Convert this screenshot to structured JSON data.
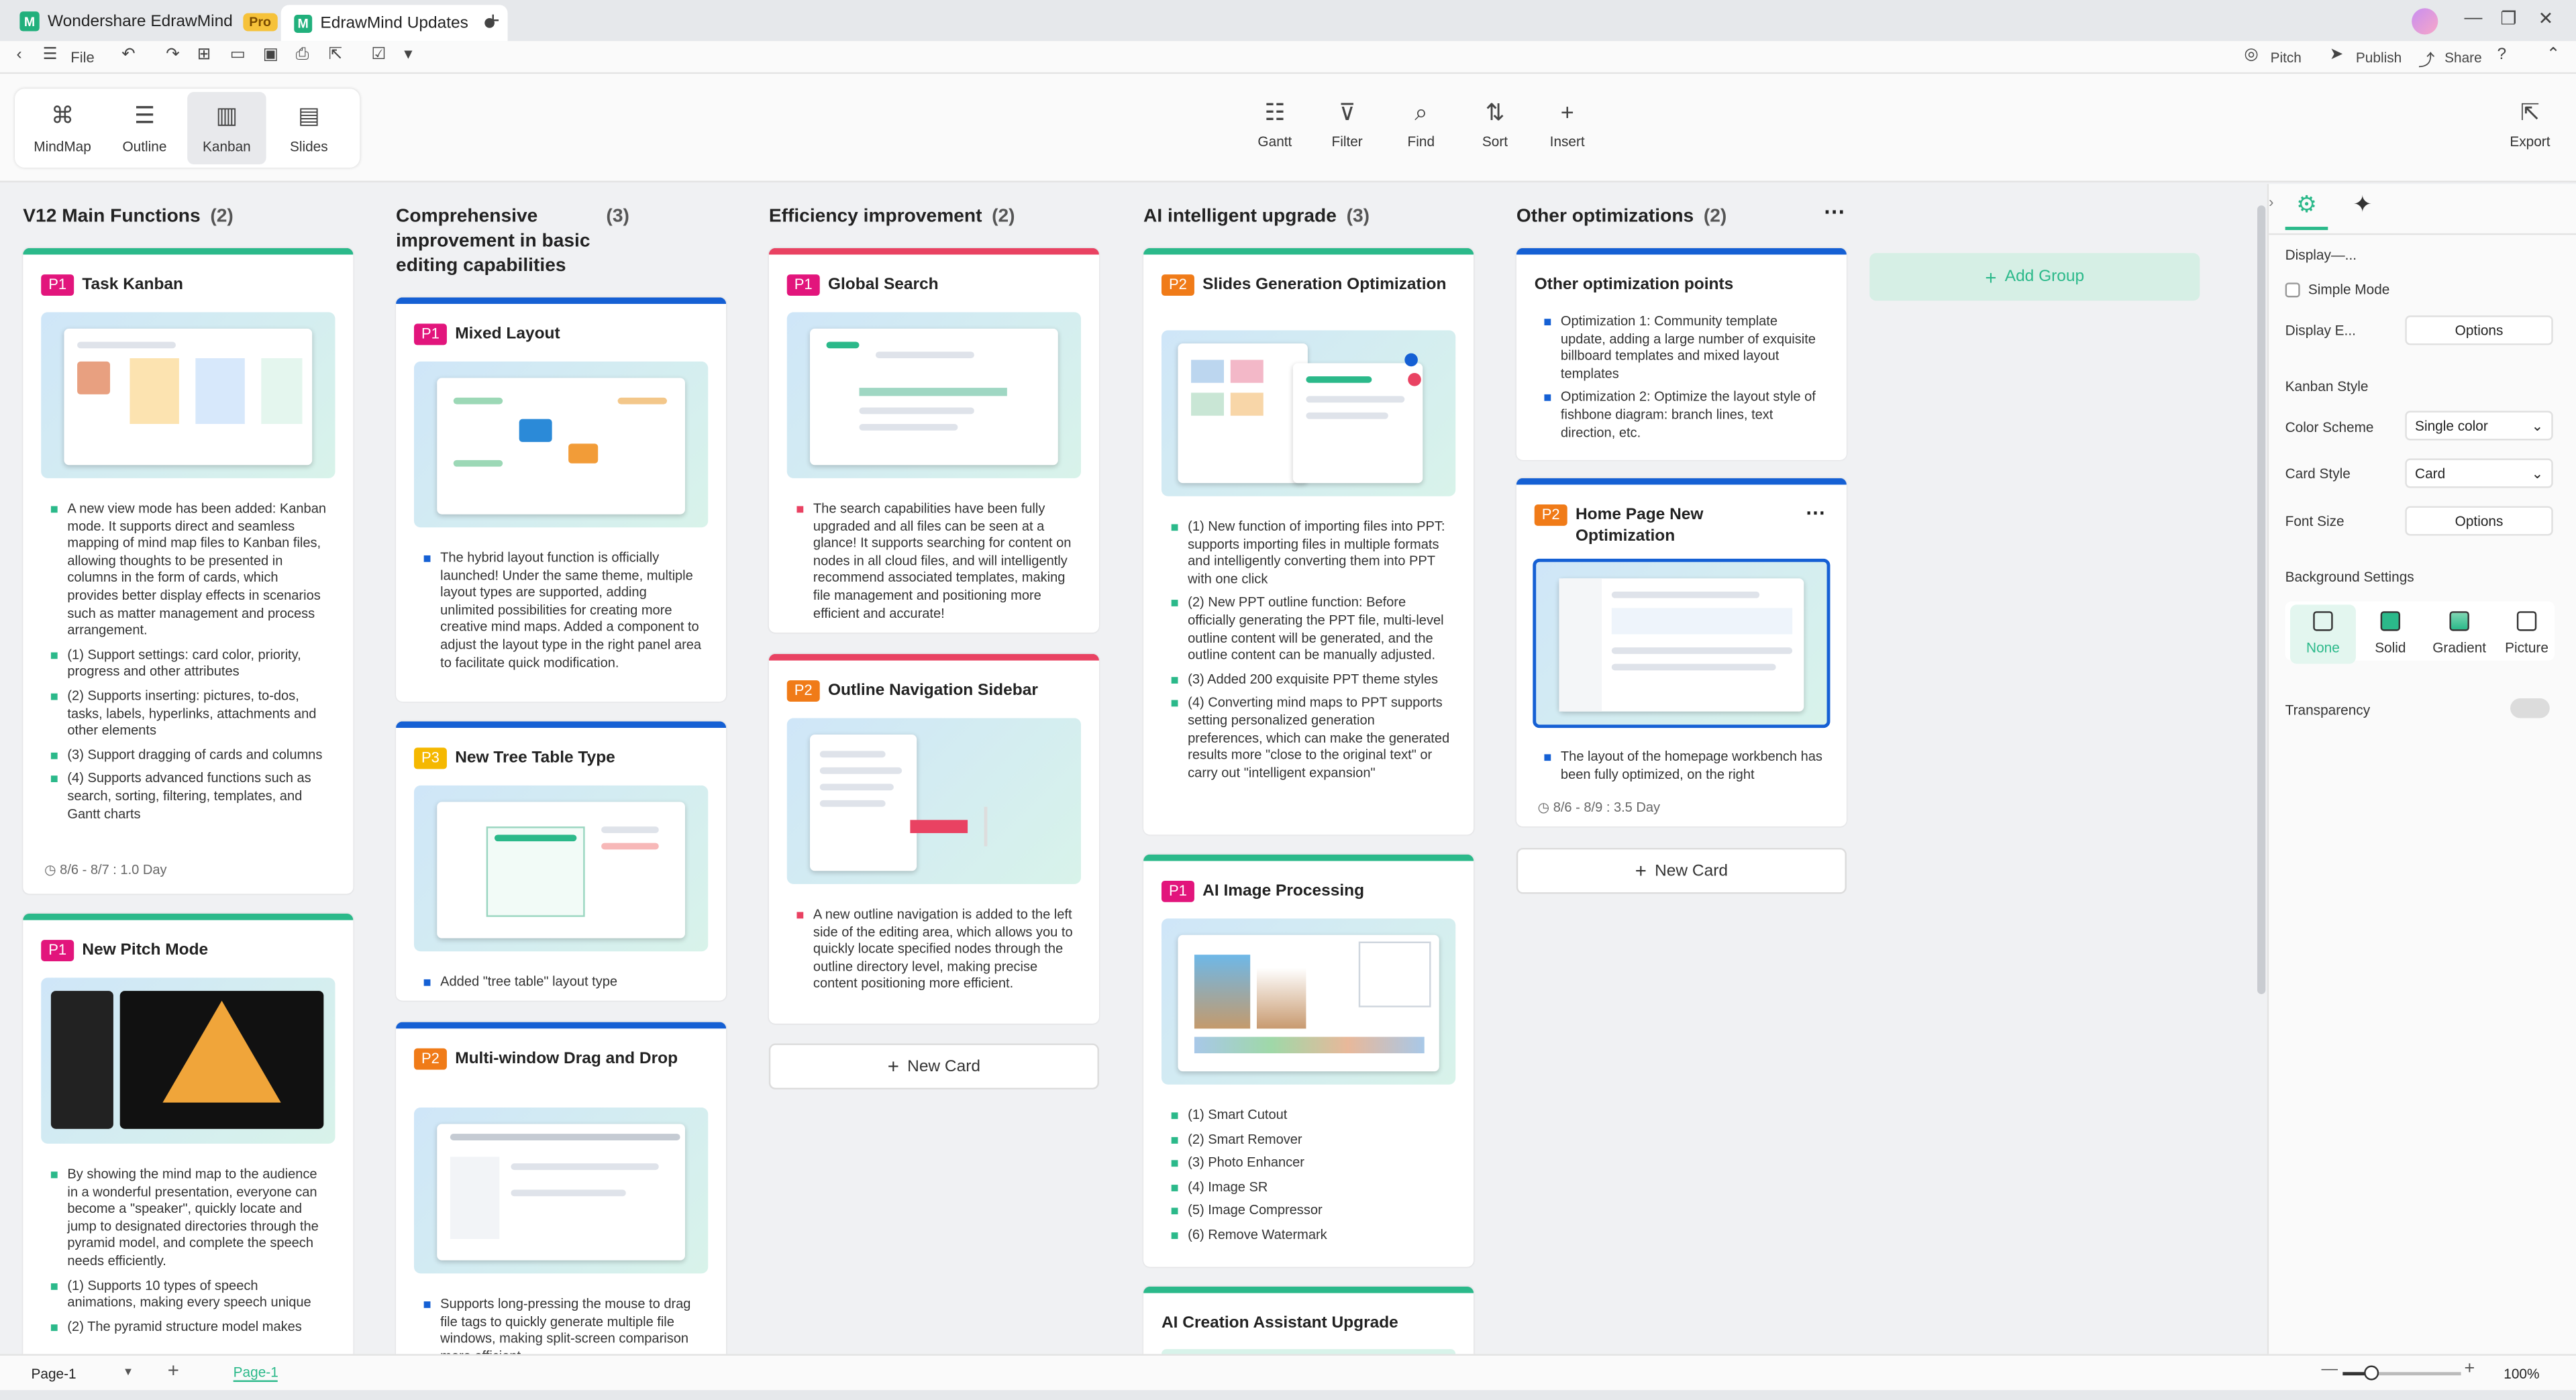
{
  "window": {
    "app_tab": "Wondershare EdrawMind",
    "pro_badge": "Pro",
    "doc_tab": "EdrawMind Updates"
  },
  "quickbar": {
    "file": "File"
  },
  "topright": {
    "pitch": "Pitch",
    "publish": "Publish",
    "share": "Share"
  },
  "views": [
    {
      "label": "MindMap",
      "icon": "mindmap-icon"
    },
    {
      "label": "Outline",
      "icon": "outline-icon"
    },
    {
      "label": "Kanban",
      "icon": "kanban-icon"
    },
    {
      "label": "Slides",
      "icon": "slides-icon"
    }
  ],
  "tools": [
    {
      "label": "Gantt",
      "icon": "gantt-icon"
    },
    {
      "label": "Filter",
      "icon": "filter-icon"
    },
    {
      "label": "Find",
      "icon": "find-icon"
    },
    {
      "label": "Sort",
      "icon": "sort-icon"
    },
    {
      "label": "Insert",
      "icon": "plus-icon"
    }
  ],
  "export_label": "Export",
  "columns": [
    {
      "title": "V12 Main Functions",
      "count": "(2)",
      "cards": [
        {
          "prio": "P1",
          "title": "Task Kanban",
          "bullets": [
            "A new view mode has been added: Kanban mode. It supports direct and seamless mapping of mind map files to Kanban files, allowing thoughts to be presented in columns in the form of cards, which provides better display effects in scenarios such as matter management and process arrangement.",
            "(1) Support settings: card color, priority, progress and other attributes",
            "(2) Supports inserting: pictures, to-dos, tasks, labels, hyperlinks, attachments and other elements",
            "(3) Support dragging of cards and columns",
            "(4) Supports advanced functions such as search, sorting, filtering, templates, and Gantt charts"
          ],
          "date": "8/6 - 8/7 : 1.0 Day"
        },
        {
          "prio": "P1",
          "title": "New Pitch Mode",
          "bullets": [
            "By showing the mind map to the audience in a wonderful presentation, everyone can become a \"speaker\", quickly locate and jump to designated directories through the pyramid model, and complete the speech needs efficiently.",
            "(1) Supports 10 types of speech animations, making every speech unique",
            "(2) The pyramid structure model makes"
          ]
        }
      ]
    },
    {
      "title": "Comprehensive improvement in basic editing capabilities",
      "count": "(3)",
      "cards": [
        {
          "prio": "P1",
          "title": "Mixed Layout",
          "bullets": [
            "The hybrid layout function is officially launched! Under the same theme, multiple layout types are supported, adding unlimited possibilities for creating more creative mind maps. Added a component to adjust the layout type in the right panel area to facilitate quick modification."
          ]
        },
        {
          "prio": "P3",
          "title": "New Tree Table Type",
          "bullets": [
            "Added \"tree table\" layout type"
          ]
        },
        {
          "prio": "P2",
          "title": "Multi-window Drag and Drop",
          "bullets": [
            "Supports long-pressing the mouse to drag file tags to quickly generate multiple file windows, making split-screen comparison more efficient."
          ]
        }
      ]
    },
    {
      "title": "Efficiency improvement",
      "count": "(2)",
      "cards": [
        {
          "prio": "P1",
          "title": "Global Search",
          "bullets": [
            "The search capabilities have been fully upgraded and all files can be seen at a glance! It supports searching for content on nodes in all cloud files, and will intelligently recommend associated templates, making file management and positioning more efficient and accurate!"
          ]
        },
        {
          "prio": "P2",
          "title": "Outline Navigation Sidebar",
          "bullets": [
            "A new outline navigation is added to the left side of the editing area, which allows you to quickly locate specified nodes through the outline directory level, making precise content positioning more efficient."
          ]
        }
      ],
      "new_card": "New Card"
    },
    {
      "title": "AI intelligent upgrade",
      "count": "(3)",
      "cards": [
        {
          "prio": "P2",
          "title": "Slides Generation Optimization",
          "bullets": [
            "(1) New function of importing files into PPT: supports importing files in multiple formats and intelligently converting them into PPT with one click",
            "(2) New PPT outline function: Before officially generating the PPT file, multi-level outline content will be generated, and the outline content can be manually adjusted.",
            "(3) Added 200 exquisite PPT theme styles",
            "(4) Converting mind maps to PPT supports setting personalized generation preferences, which can make the generated results more \"close to the original text\" or carry out \"intelligent expansion\""
          ]
        },
        {
          "prio": "P1",
          "title": "AI Image Processing",
          "bullets": [
            "(1) Smart Cutout",
            "(2) Smart Remover",
            "(3) Photo Enhancer",
            "(4) Image SR",
            "(5) Image Compressor",
            "(6) Remove Watermark"
          ]
        },
        {
          "title": "AI Creation Assistant Upgrade"
        }
      ]
    },
    {
      "title": "Other optimizations",
      "count": "(2)",
      "cards": [
        {
          "title": "Other optimization points",
          "bullets": [
            "Optimization 1: Community template update, adding a large number of exquisite billboard templates and mixed layout templates",
            "Optimization 2: Optimize the layout style of fishbone diagram: branch lines, text direction, etc."
          ]
        },
        {
          "prio": "P2",
          "title": "Home Page New Optimization",
          "bullets": [
            "The layout of the homepage workbench has been fully optimized, on the right"
          ],
          "date": "8/6 - 8/9 : 3.5 Day"
        }
      ],
      "new_card": "New Card"
    }
  ],
  "add_group": "Add Group",
  "panel": {
    "display": "Display—...",
    "simple_mode": "Simple Mode",
    "display_e": "Display E...",
    "options": "Options",
    "kanban_style": "Kanban Style",
    "color_scheme": "Color Scheme",
    "color_scheme_value": "Single color",
    "card_style": "Card Style",
    "card_style_value": "Card",
    "font_size": "Font Size",
    "bg_settings": "Background Settings",
    "bg_options": [
      "None",
      "Solid",
      "Gradient",
      "Picture"
    ],
    "transparency": "Transparency"
  },
  "status": {
    "page_select": "Page-1",
    "page_tab": "Page-1",
    "zoom": "100%"
  },
  "colors": {
    "green": "#2bb98a",
    "blue": "#1560d4",
    "red": "#e94262",
    "p1": "#e2157c",
    "p2": "#f07b18",
    "p3": "#f5b800"
  }
}
